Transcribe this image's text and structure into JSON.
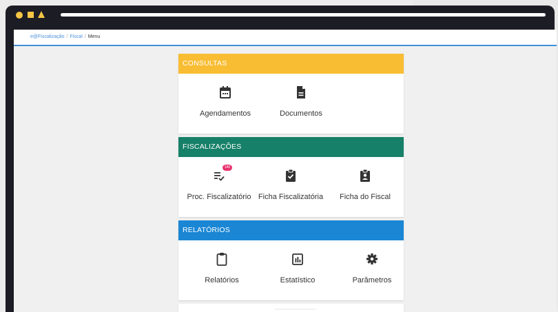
{
  "colors": {
    "consultas": "#f8bd33",
    "fiscalizacoes": "#168068",
    "relatorios": "#1a86d4",
    "icon": "#333333",
    "badge": "#e8336e"
  },
  "breadcrumb": {
    "items": [
      "e@Fiscalização",
      "Fiscal"
    ],
    "current": "Menu",
    "separator": "/"
  },
  "sections": {
    "consultas": {
      "title": "CONSULTAS",
      "items": [
        {
          "label": "Agendamentos",
          "icon": "calendar-icon"
        },
        {
          "label": "Documentos",
          "icon": "document-icon"
        }
      ]
    },
    "fiscalizacoes": {
      "title": "FISCALIZAÇÕES",
      "items": [
        {
          "label": "Proc. Fiscalizatório",
          "icon": "checklist-icon",
          "badge": "140"
        },
        {
          "label": "Ficha Fiscalizatória",
          "icon": "clipboard-check-icon"
        },
        {
          "label": "Ficha do Fiscal",
          "icon": "clipboard-person-icon"
        }
      ]
    },
    "relatorios": {
      "title": "RELATÓRIOS",
      "items": [
        {
          "label": "Relatórios",
          "icon": "clipboard-icon"
        },
        {
          "label": "Estatístico",
          "icon": "bar-chart-icon"
        },
        {
          "label": "Parâmetros",
          "icon": "gear-icon"
        }
      ]
    }
  }
}
